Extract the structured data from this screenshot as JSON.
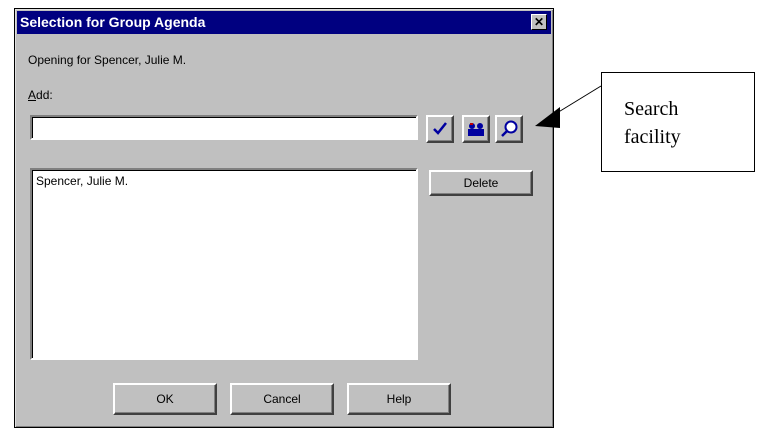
{
  "dialog": {
    "title": "Selection for Group Agenda",
    "close_glyph": "✕",
    "opening_text": "Opening for Spencer, Julie M.",
    "add_label": "Add:",
    "add_input_value": "",
    "selected_list": [
      "Spencer, Julie M."
    ],
    "buttons": {
      "delete": "Delete",
      "ok": "OK",
      "cancel": "Cancel",
      "help": "Help"
    },
    "icons": [
      "checkmark-icon",
      "group-people-icon",
      "magnifier-search-icon"
    ]
  },
  "callout": {
    "line1": "Search",
    "line2": "facility"
  },
  "colors": {
    "titlebar": "#000080",
    "dialog_bg": "#c0c0c0",
    "check_blue": "#0000a0"
  }
}
